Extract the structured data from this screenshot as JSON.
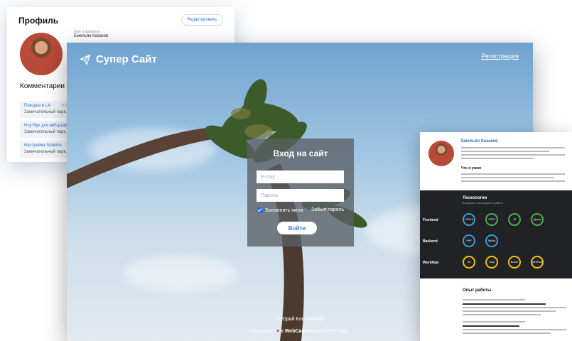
{
  "profile_card": {
    "title": "Профиль",
    "edit_label": "Редактировать",
    "name_label": "Имя и фамилия",
    "name": "Емельян Казаков",
    "comments_title": "Комментарии по",
    "comments": [
      {
        "title": "Поездка в LA",
        "meta": "15 Мая",
        "text": "Замечательный парк, об"
      },
      {
        "title": "Ноутбук для веб-разраб",
        "meta": "",
        "text": "Замечательный парк, об"
      },
      {
        "title": "Настройка Sublime",
        "meta": "",
        "text": "Замечательный парк, об"
      }
    ]
  },
  "main": {
    "brand": "Супер Сайт",
    "register": "Регистрация",
    "login": {
      "title": "Вход на сайт",
      "email_placeholder": "E-mail",
      "password_placeholder": "Пароль",
      "remember": "Запомнить меня",
      "forgot": "Забыл пароль",
      "submit": "Войти"
    },
    "footer": {
      "line1": "© Юрий Ключевский",
      "prefix": "Создано с",
      "heart": "♥",
      "mid": "в",
      "site": "WebCademy.ru",
      "suffix": "в 2017 году"
    }
  },
  "resume": {
    "name": "Емельян Казаков",
    "what_title": "Что я умею",
    "tech_title": "Технологии",
    "tech_sub": "Которые я использую в работе",
    "rows": [
      {
        "label": "Frontend",
        "skills": [
          "HTML5",
          "CSS3",
          "JS",
          "jQuery"
        ]
      },
      {
        "label": "Backend",
        "skills": [
          "PHP",
          "MySql"
        ]
      },
      {
        "label": "Workflow",
        "skills": [
          "Git",
          "Gulp",
          "Bower",
          "WebPack"
        ]
      }
    ],
    "ring_colors": [
      "#3a9bdc",
      "#4caf50",
      "#4caf50",
      "#4caf50",
      "#3a9bdc",
      "#3a9bdc",
      "#f2c200",
      "#f2c200",
      "#f2c200",
      "#f2c200"
    ],
    "exp_title": "Опыт работы"
  },
  "colors": {
    "accent": "#2c6fce",
    "button_text": "#3a7bd5",
    "checkbox": "#2f6fd8",
    "heart": "#e23b3b"
  }
}
